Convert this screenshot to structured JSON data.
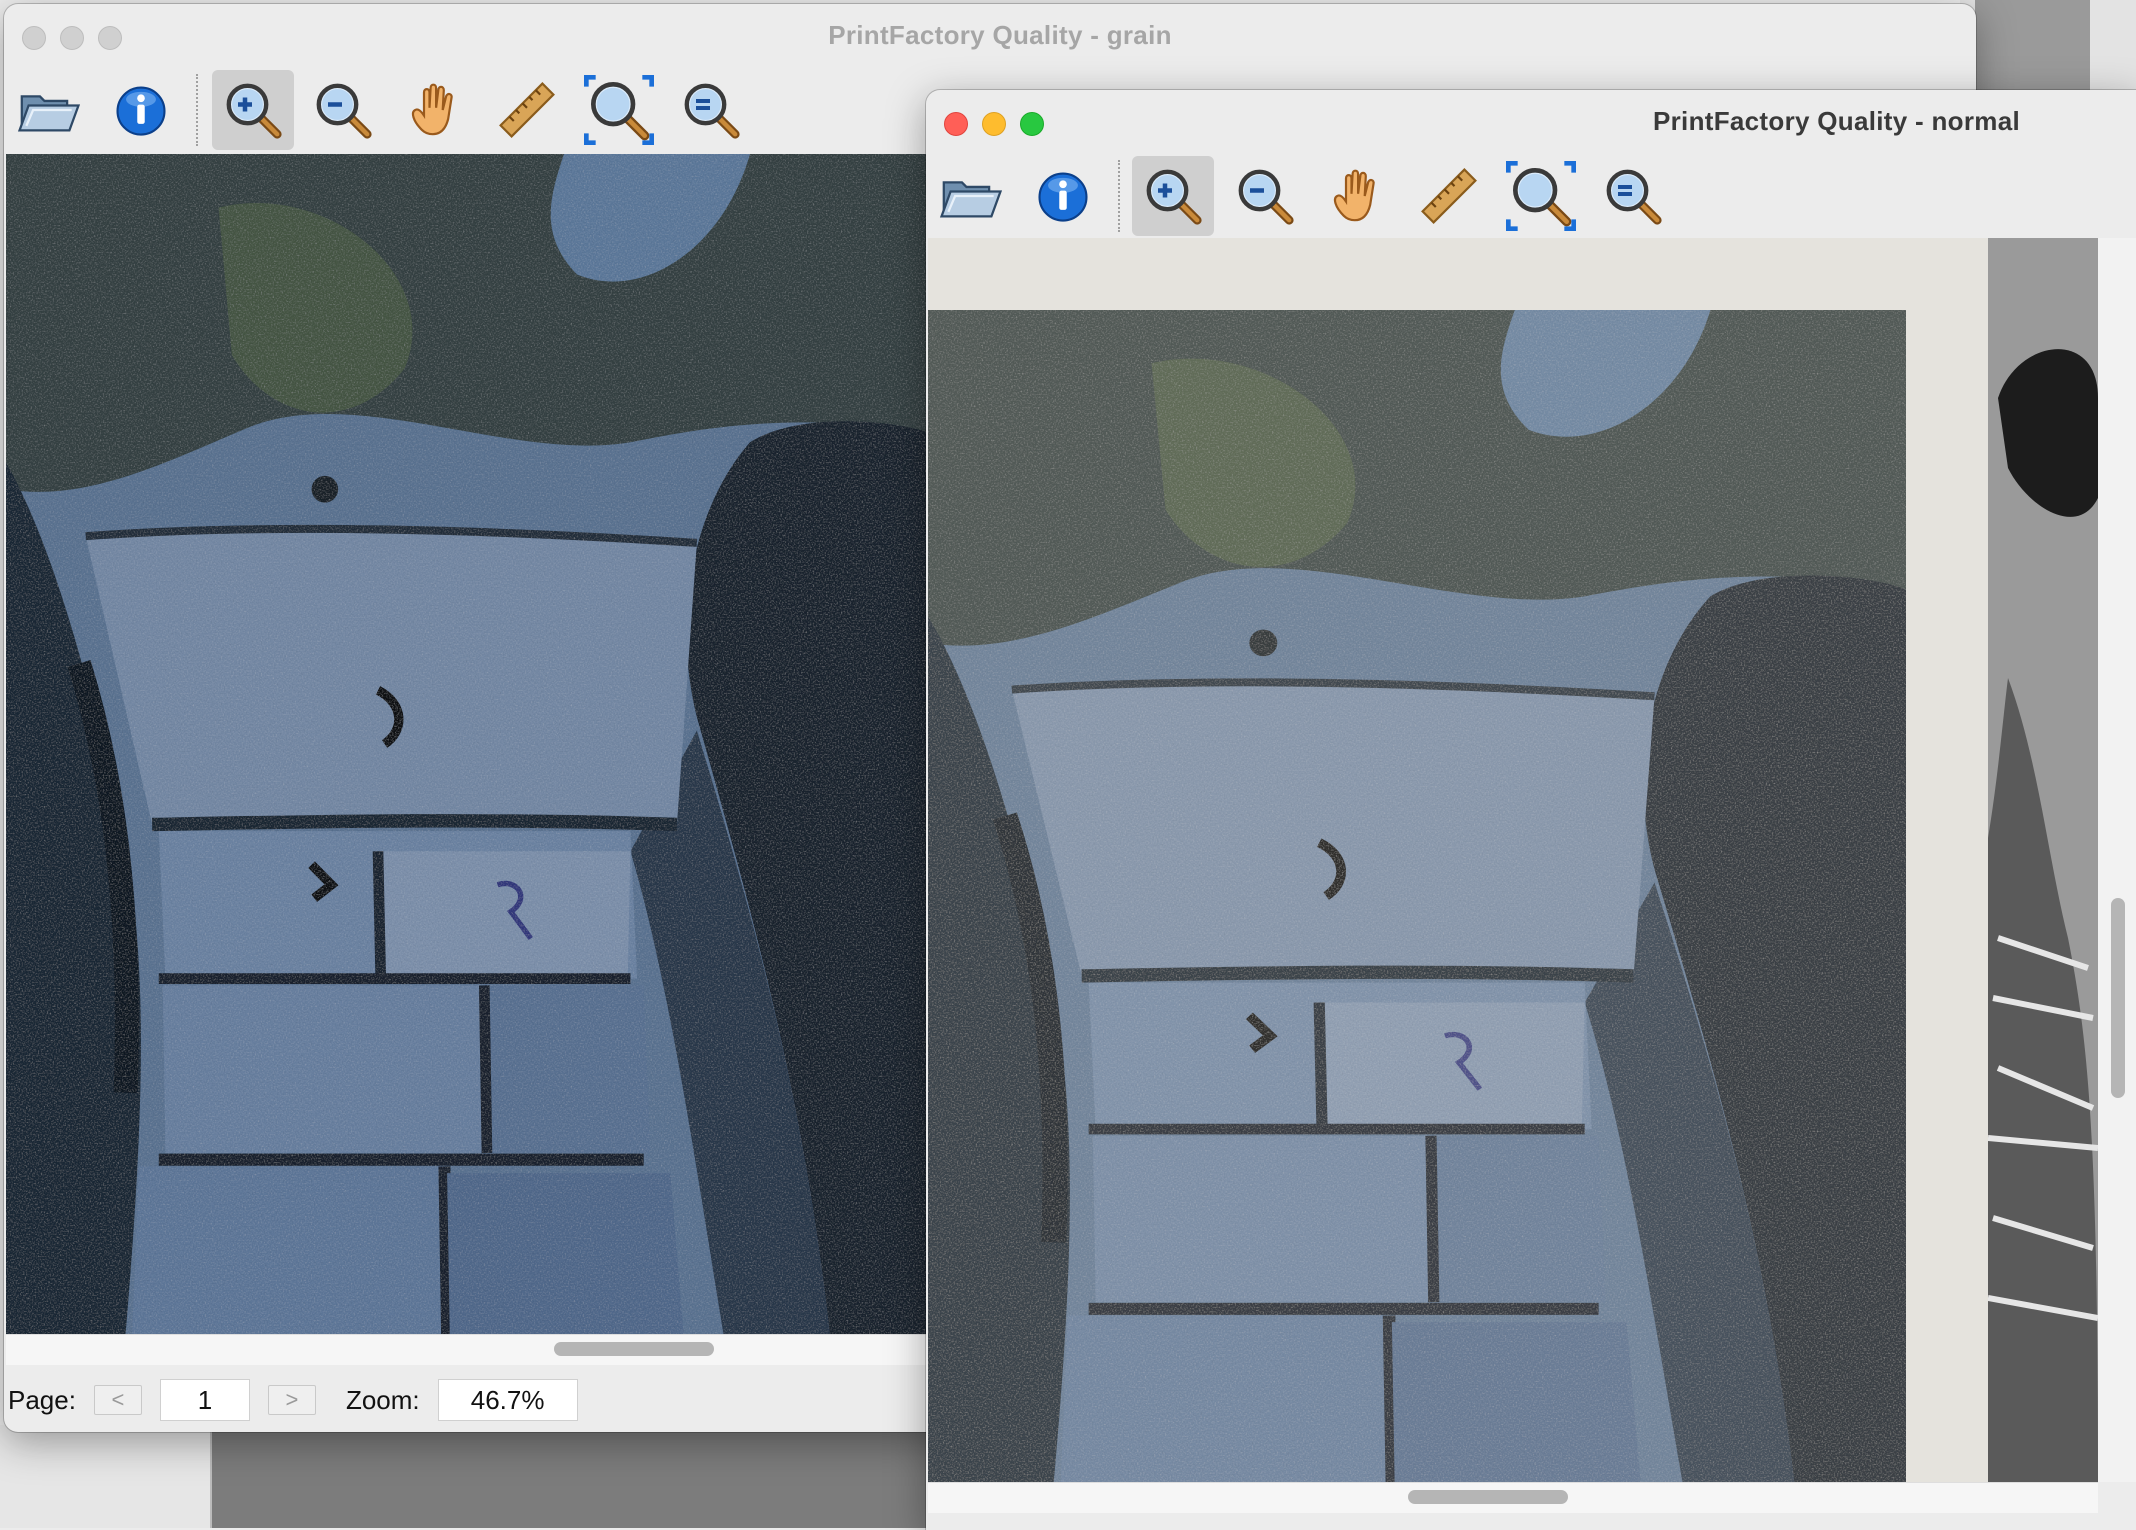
{
  "windows": {
    "grain": {
      "title": "PrintFactory Quality - grain",
      "status": {
        "page_label": "Page:",
        "prev_label": "<",
        "page_value": "1",
        "next_label": ">",
        "zoom_label": "Zoom:",
        "zoom_value": "46.7%"
      }
    },
    "normal": {
      "title": "PrintFactory Quality - normal"
    }
  },
  "toolbar": {
    "tools": [
      "open-folder",
      "info",
      "zoom-in",
      "zoom-out",
      "pan-hand",
      "ruler",
      "zoom-fit",
      "zoom-actual"
    ],
    "active_tool": "zoom-in"
  },
  "colors": {
    "accent_blue": "#1b6fd8",
    "close": "#ff5f57",
    "minimize": "#febc2e",
    "maximize": "#28c840"
  }
}
